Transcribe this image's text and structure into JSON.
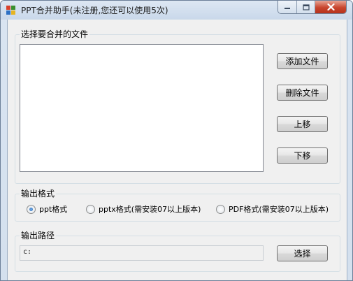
{
  "window": {
    "title": "PPT合并助手(未注册,您还可以使用5次)",
    "app_icon": "ppt-app-icon",
    "controls": {
      "minimize_icon": "minimize-icon",
      "maximize_icon": "maximize-icon",
      "close_icon": "close-icon"
    }
  },
  "file_group": {
    "label": "选择要合并的文件",
    "files": [],
    "buttons": {
      "add": "添加文件",
      "delete": "删除文件",
      "up": "上移",
      "down": "下移"
    }
  },
  "format_group": {
    "label": "输出格式",
    "options": [
      {
        "label": "ppt格式",
        "selected": true
      },
      {
        "label": "pptx格式(需安装07以上版本)",
        "selected": false
      },
      {
        "label": "PDF格式(需安装07以上版本)",
        "selected": false
      }
    ]
  },
  "path_group": {
    "label": "输出路径",
    "path_value": "c:",
    "select_button": "选择"
  },
  "colors": {
    "close_button": "#c8452d",
    "radio_selected": "#1b5fb0",
    "window_frame": "#d4e0ee"
  }
}
